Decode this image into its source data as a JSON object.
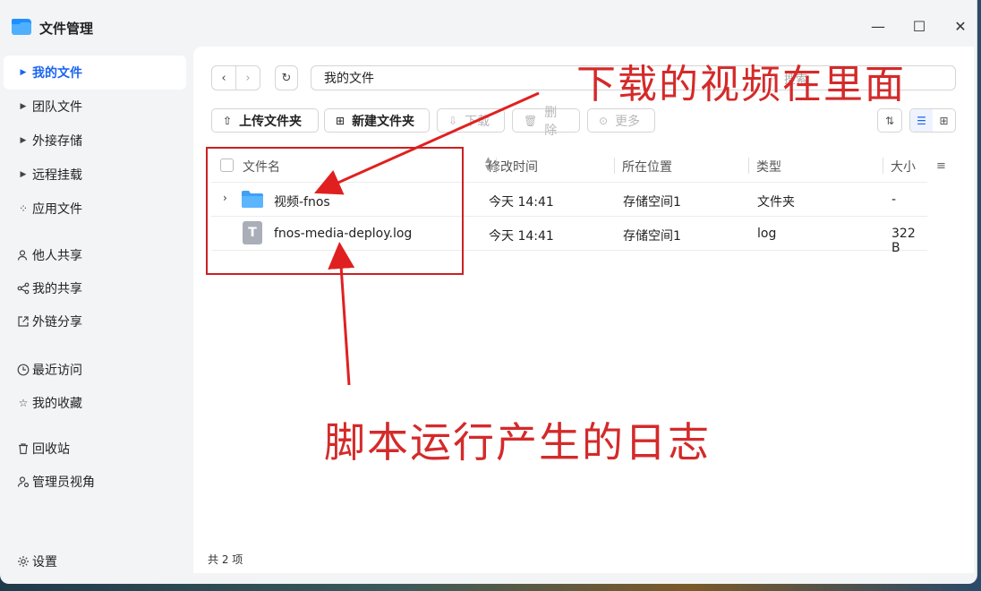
{
  "window": {
    "title": "文件管理",
    "controls": {
      "minimize": "—",
      "maximize": "☐",
      "close": "✕"
    }
  },
  "sidebar": {
    "items": [
      {
        "label": "我的文件",
        "icon": "caret-right-icon",
        "active": true
      },
      {
        "label": "团队文件",
        "icon": "caret-right-icon"
      },
      {
        "label": "外接存储",
        "icon": "caret-right-icon"
      },
      {
        "label": "远程挂载",
        "icon": "caret-right-icon"
      },
      {
        "label": "应用文件",
        "icon": "apps-icon"
      },
      {
        "label": "他人共享",
        "icon": "users-icon"
      },
      {
        "label": "我的共享",
        "icon": "share-icon"
      },
      {
        "label": "外链分享",
        "icon": "external-link-icon"
      },
      {
        "label": "最近访问",
        "icon": "clock-icon"
      },
      {
        "label": "我的收藏",
        "icon": "star-icon"
      },
      {
        "label": "回收站",
        "icon": "trash-icon"
      },
      {
        "label": "管理员视角",
        "icon": "admin-icon"
      },
      {
        "label": "设置",
        "icon": "gear-icon"
      }
    ]
  },
  "toolbar": {
    "path": "我的文件",
    "search_placeholder": "搜索",
    "upload_label": "上传文件夹",
    "new_folder_label": "新建文件夹",
    "download_label": "下载",
    "delete_label": "删除",
    "more_label": "更多"
  },
  "table": {
    "headers": {
      "name": "文件名",
      "modified": "修改时间",
      "location": "所在位置",
      "type": "类型",
      "size": "大小"
    },
    "rows": [
      {
        "name": "视频-fnos",
        "modified": "今天 14:41",
        "location": "存储空间1",
        "type": "文件夹",
        "size": "-",
        "kind": "folder"
      },
      {
        "name": "fnos-media-deploy.log",
        "modified": "今天 14:41",
        "location": "存储空间1",
        "type": "log",
        "size": "322 B",
        "kind": "file"
      }
    ]
  },
  "footer": {
    "count_text": "共 2 项"
  },
  "annotations": {
    "top_text": "下载的视频在里面",
    "bottom_text": "脚本运行产生的日志",
    "color": "#d42a2a"
  },
  "colors": {
    "accent": "#1a64f0",
    "annotation": "#cc2020"
  }
}
